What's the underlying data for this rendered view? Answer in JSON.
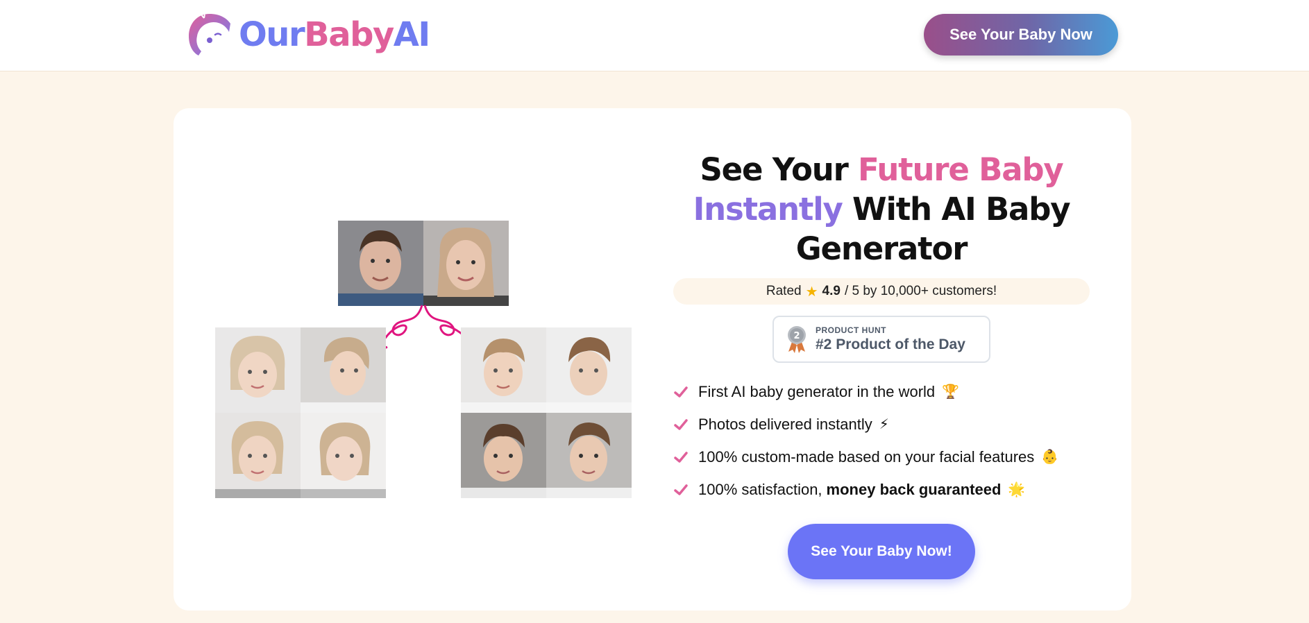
{
  "header": {
    "logo": {
      "our": "Our",
      "baby": "Baby",
      "ai": "AI"
    },
    "cta_label": "See Your Baby Now"
  },
  "hero": {
    "headline": {
      "part1": "See Your ",
      "part2": "Future Baby",
      "part3": "Instantly",
      "part4": " With AI Baby Generator"
    },
    "rating": {
      "prefix": "Rated",
      "star_icon": "star-icon",
      "score": "4.9",
      "suffix": "/ 5 by 10,000+ customers!"
    },
    "product_hunt": {
      "label": "PRODUCT HUNT",
      "title": "#2 Product of the Day",
      "medal_number": "2"
    },
    "features": [
      {
        "text": "First AI baby generator in the world",
        "bold": "",
        "emoji": "🏆"
      },
      {
        "text": "Photos delivered instantly",
        "bold": "",
        "emoji": "⚡"
      },
      {
        "text": "100% custom-made based on your facial features",
        "bold": "",
        "emoji": "👶"
      },
      {
        "text": "100% satisfaction,",
        "bold": "money back guaranteed",
        "emoji": "🌟"
      }
    ],
    "cta_label": "See Your Baby Now!"
  },
  "colors": {
    "page_bg": "#fdf5ea",
    "card_bg": "#ffffff",
    "accent_pink": "#e0609a",
    "accent_blue": "#6f7cf0",
    "cta": "#6b74f6"
  }
}
